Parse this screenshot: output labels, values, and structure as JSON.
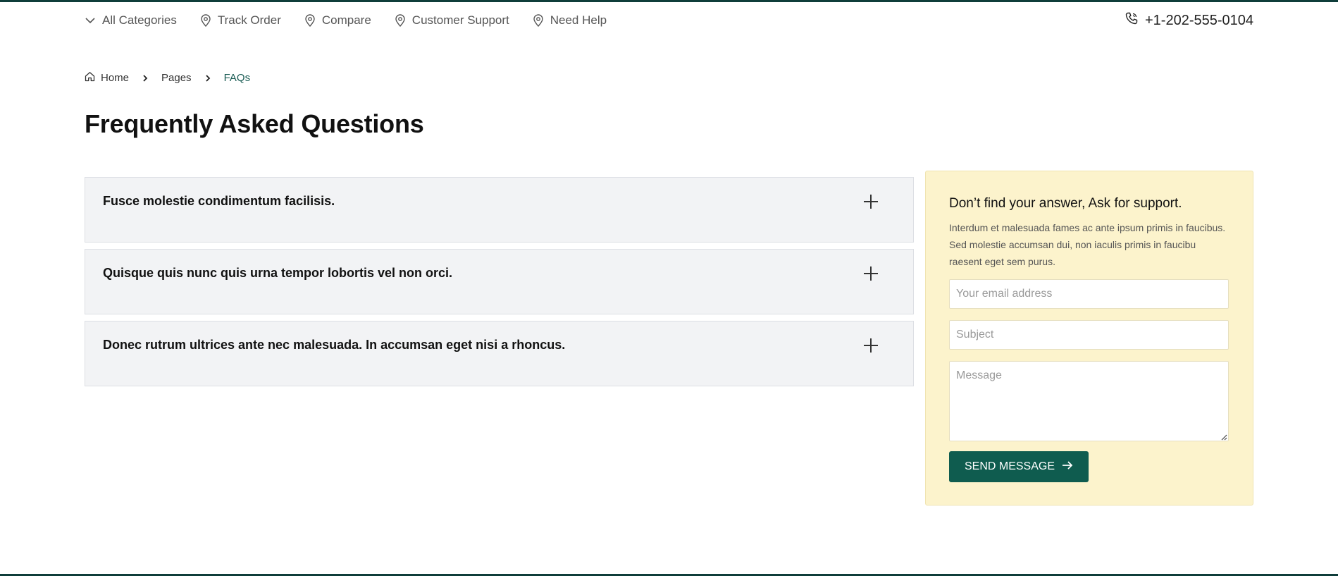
{
  "colors": {
    "brand": "#0f5c4f",
    "accent_dark": "#0f3d3a",
    "panel_bg": "#fcf3cc",
    "faq_bg": "#f2f3f5"
  },
  "topnav": {
    "items": [
      {
        "label": "All Categories",
        "icon": "chevron-down-icon"
      },
      {
        "label": "Track Order",
        "icon": "location-pin-icon"
      },
      {
        "label": "Compare",
        "icon": "location-pin-icon"
      },
      {
        "label": "Customer Support",
        "icon": "location-pin-icon"
      },
      {
        "label": "Need Help",
        "icon": "location-pin-icon"
      }
    ],
    "phone": {
      "number": "+1-202-555-0104",
      "icon": "phone-icon"
    }
  },
  "breadcrumb": {
    "items": [
      "Home",
      "Pages",
      "FAQs"
    ],
    "home_icon": "home-icon",
    "separator_icon": "chevron-right-icon"
  },
  "page": {
    "title": "Frequently Asked Questions"
  },
  "faqs": [
    {
      "question": "Fusce molestie condimentum facilisis.",
      "icon": "plus-icon"
    },
    {
      "question": "Quisque quis nunc quis urna tempor lobortis vel non orci.",
      "icon": "plus-icon"
    },
    {
      "question": "Donec rutrum ultrices ante nec malesuada. In accumsan eget nisi a rhoncus.",
      "icon": "plus-icon"
    }
  ],
  "support": {
    "title": "Don’t find your answer, Ask for support.",
    "description": "Interdum et malesuada fames ac ante ipsum primis in faucibus. Sed molestie accumsan dui, non iaculis primis in faucibu raesent eget sem purus.",
    "email_placeholder": "Your email address",
    "email_value": "",
    "subject_placeholder": "Subject",
    "subject_value": "",
    "message_placeholder": "Message",
    "message_value": "",
    "send_label": "SEND MESSAGE",
    "send_icon": "arrow-right-icon"
  }
}
